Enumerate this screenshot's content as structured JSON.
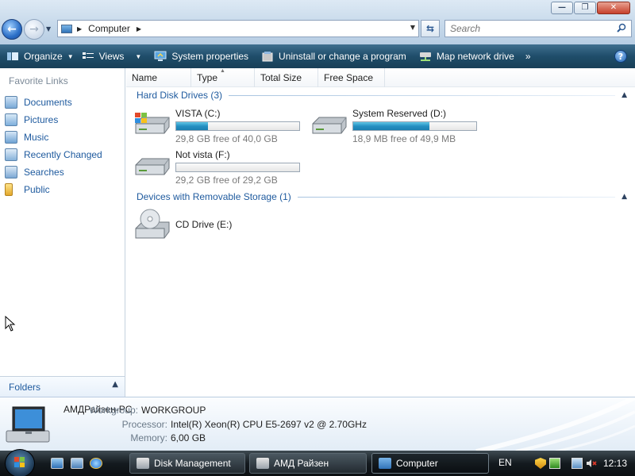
{
  "window": {
    "minimize_glyph": "—",
    "maximize_glyph": "❐",
    "close_glyph": "✕"
  },
  "address": {
    "crumb": "Computer",
    "search_placeholder": "Search"
  },
  "toolbar": {
    "organize": "Organize",
    "views": "Views",
    "system_properties": "System properties",
    "uninstall": "Uninstall or change a program",
    "map_drive": "Map network drive",
    "more": "»",
    "help": "?"
  },
  "nav": {
    "favorite_links_title": "Favorite Links",
    "items": [
      {
        "label": "Documents",
        "icon": "documents-icon"
      },
      {
        "label": "Pictures",
        "icon": "pictures-icon"
      },
      {
        "label": "Music",
        "icon": "music-icon"
      },
      {
        "label": "Recently Changed",
        "icon": "recently-changed-icon"
      },
      {
        "label": "Searches",
        "icon": "searches-icon"
      },
      {
        "label": "Public",
        "icon": "public-folder-icon"
      }
    ],
    "folders_label": "Folders"
  },
  "columns": [
    "Name",
    "Type",
    "Total Size",
    "Free Space"
  ],
  "groups": {
    "hdd_title": "Hard Disk Drives (3)",
    "removable_title": "Devices with Removable Storage (1)"
  },
  "drives": [
    {
      "name": "VISTA (C:)",
      "free_text": "29,8 GB free of 40,0 GB",
      "used_fraction": 0.255
    },
    {
      "name": "System Reserved (D:)",
      "free_text": "18,9 MB free of 49,9 MB",
      "used_fraction": 0.621
    },
    {
      "name": "Not vista (F:)",
      "free_text": "29,2 GB free of 29,2 GB",
      "used_fraction": 0.0
    }
  ],
  "removable": [
    {
      "name": "CD Drive (E:)"
    }
  ],
  "details": {
    "pc_name": "АМДРайзен-PC",
    "workgroup_label": "Workgroup:",
    "workgroup_value": "WORKGROUP",
    "processor_label": "Processor:",
    "processor_value": "Intel(R) Xeon(R) CPU E5-2697 v2 @ 2.70GHz",
    "memory_label": "Memory:",
    "memory_value": "6,00 GB"
  },
  "taskbar": {
    "tasks": [
      "Disk Management",
      "АМД Райзен",
      "Computer"
    ],
    "language": "EN",
    "clock": "12:13"
  },
  "colors": {
    "accent_link": "#1e5a9e",
    "bar_fill": "#2590c2",
    "toolbar_bg": "#1f4d6a"
  }
}
